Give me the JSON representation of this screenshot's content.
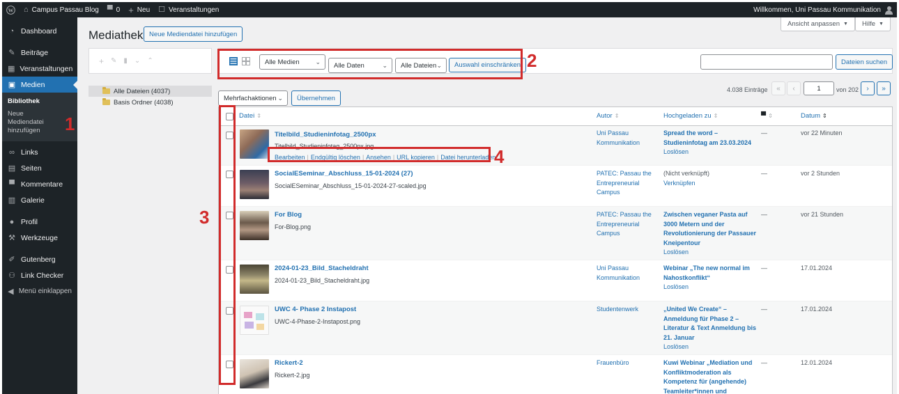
{
  "admin_bar": {
    "site_name": "Campus Passau Blog",
    "comments_count": "0",
    "new_label": "Neu",
    "events_label": "Veranstaltungen",
    "greeting": "Willkommen, Uni Passau Kommunikation"
  },
  "sidebar": {
    "items": [
      {
        "label": "Dashboard",
        "icon": "dashboard-icon"
      },
      {
        "label": "Beiträge",
        "icon": "pin-icon"
      },
      {
        "label": "Veranstaltungen",
        "icon": "calendar-icon"
      },
      {
        "label": "Medien",
        "icon": "media-icon"
      },
      {
        "label": "Links",
        "icon": "link-icon"
      },
      {
        "label": "Seiten",
        "icon": "pages-icon"
      },
      {
        "label": "Kommentare",
        "icon": "comment-icon"
      },
      {
        "label": "Galerie",
        "icon": "gallery-icon"
      },
      {
        "label": "Profil",
        "icon": "user-icon"
      },
      {
        "label": "Werkzeuge",
        "icon": "wrench-icon"
      },
      {
        "label": "Gutenberg",
        "icon": "pencil-icon"
      },
      {
        "label": "Link Checker",
        "icon": "link-checker-icon"
      }
    ],
    "submenu": [
      "Bibliothek",
      "Neue Mediendatei hinzufügen"
    ],
    "collapse_label": "Menü einklappen"
  },
  "header": {
    "title": "Mediathek",
    "add_button": "Neue Mediendatei hinzufügen",
    "screen_options": "Ansicht anpassen",
    "help": "Hilfe"
  },
  "folders": [
    {
      "label": "Alle Dateien (4037)"
    },
    {
      "label": "Basis Ordner (4038)"
    }
  ],
  "toolbar": {
    "media_filter": "Alle Medien",
    "date_filter": "Alle Daten",
    "file_filter": "Alle Dateien",
    "filter_button": "Auswahl einschränken",
    "search_value": "",
    "search_button": "Dateien suchen",
    "bulk_actions": "Mehrfachaktionen",
    "apply_button": "Übernehmen"
  },
  "pagination": {
    "count": "4.038 Einträge",
    "current_page": "1",
    "of_pages": "von 202"
  },
  "table": {
    "columns": [
      "Datei",
      "Autor",
      "Hochgeladen zu",
      "Datum"
    ],
    "row_actions": [
      "Bearbeiten",
      "Endgültig löschen",
      "Ansehen",
      "URL kopieren",
      "Datei herunterladen"
    ],
    "rows": [
      {
        "title": "Titelbild_Studieninfotag_2500px",
        "file": "Titelbild_Studieninfotag_2500px.jpg",
        "author": [
          "Uni Passau",
          "Kommunikation"
        ],
        "uploaded_to": [
          "Spread the word –",
          "Studieninfotag am 23.03.2024"
        ],
        "uploaded_action": "Loslösen",
        "comments": "—",
        "date": "vor 22 Minuten"
      },
      {
        "title": "SocialESeminar_Abschluss_15-01-2024 (27)",
        "file": "SocialESeminar_Abschluss_15-01-2024-27-scaled.jpg",
        "author": [
          "PATEC: Passau the",
          "Entrepreneurial",
          "Campus"
        ],
        "uploaded_to": [
          "(Nicht verknüpft)"
        ],
        "uploaded_action": "Verknüpfen",
        "comments": "—",
        "date": "vor 2 Stunden"
      },
      {
        "title": "For Blog",
        "file": "For-Blog.png",
        "author": [
          "PATEC: Passau the",
          "Entrepreneurial",
          "Campus"
        ],
        "uploaded_to": [
          "Zwischen veganer Pasta auf",
          "3000 Metern und der",
          "Revolutionierung der Passauer",
          "Kneipentour"
        ],
        "uploaded_action": "Loslösen",
        "comments": "—",
        "date": "vor 21 Stunden"
      },
      {
        "title": "2024-01-23_Bild_Stacheldraht",
        "file": "2024-01-23_Bild_Stacheldraht.jpg",
        "author": [
          "Uni Passau",
          "Kommunikation"
        ],
        "uploaded_to": [
          "Webinar „The new normal im",
          "Nahostkonflikt“"
        ],
        "uploaded_action": "Loslösen",
        "comments": "—",
        "date": "17.01.2024"
      },
      {
        "title": "UWC 4- Phase 2 Instapost",
        "file": "UWC-4-Phase-2-Instapost.png",
        "author": [
          "Studentenwerk"
        ],
        "uploaded_to": [
          "„United We Create“ –",
          "Anmeldung für Phase 2 –",
          "Literatur & Text Anmeldung bis",
          "21. Januar"
        ],
        "uploaded_action": "Loslösen",
        "comments": "—",
        "date": "17.01.2024"
      },
      {
        "title": "Rickert-2",
        "file": "Rickert-2.jpg",
        "author": [
          "Frauenbüro"
        ],
        "uploaded_to": [
          "Kuwi Webinar „Mediation und",
          "Konfliktmoderation als",
          "Kompetenz für (angehende)",
          "Teamleiter*innen und"
        ],
        "uploaded_action": "",
        "comments": "—",
        "date": "12.01.2024"
      }
    ]
  },
  "annotations": [
    "1",
    "2",
    "3",
    "4"
  ],
  "colors": {
    "accent": "#2271b1",
    "admin_dark": "#1d2327",
    "annotation_red": "#d12b2b"
  }
}
